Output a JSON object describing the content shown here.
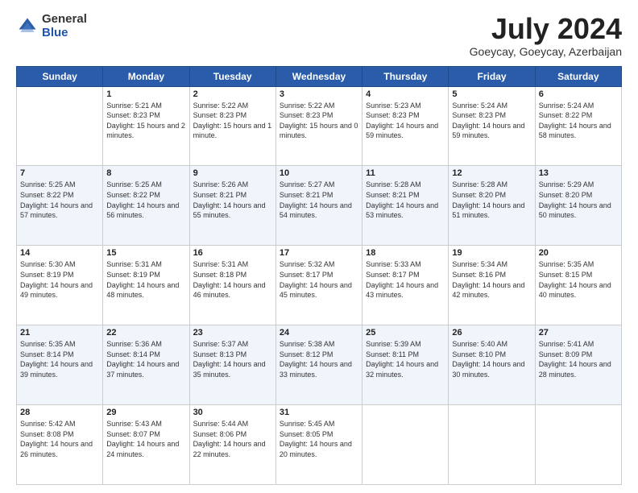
{
  "logo": {
    "general": "General",
    "blue": "Blue"
  },
  "title": "July 2024",
  "subtitle": "Goeycay, Goeycay, Azerbaijan",
  "days_header": [
    "Sunday",
    "Monday",
    "Tuesday",
    "Wednesday",
    "Thursday",
    "Friday",
    "Saturday"
  ],
  "weeks": [
    [
      {
        "day": "",
        "sunrise": "",
        "sunset": "",
        "daylight": ""
      },
      {
        "day": "1",
        "sunrise": "Sunrise: 5:21 AM",
        "sunset": "Sunset: 8:23 PM",
        "daylight": "Daylight: 15 hours and 2 minutes."
      },
      {
        "day": "2",
        "sunrise": "Sunrise: 5:22 AM",
        "sunset": "Sunset: 8:23 PM",
        "daylight": "Daylight: 15 hours and 1 minute."
      },
      {
        "day": "3",
        "sunrise": "Sunrise: 5:22 AM",
        "sunset": "Sunset: 8:23 PM",
        "daylight": "Daylight: 15 hours and 0 minutes."
      },
      {
        "day": "4",
        "sunrise": "Sunrise: 5:23 AM",
        "sunset": "Sunset: 8:23 PM",
        "daylight": "Daylight: 14 hours and 59 minutes."
      },
      {
        "day": "5",
        "sunrise": "Sunrise: 5:24 AM",
        "sunset": "Sunset: 8:23 PM",
        "daylight": "Daylight: 14 hours and 59 minutes."
      },
      {
        "day": "6",
        "sunrise": "Sunrise: 5:24 AM",
        "sunset": "Sunset: 8:22 PM",
        "daylight": "Daylight: 14 hours and 58 minutes."
      }
    ],
    [
      {
        "day": "7",
        "sunrise": "Sunrise: 5:25 AM",
        "sunset": "Sunset: 8:22 PM",
        "daylight": "Daylight: 14 hours and 57 minutes."
      },
      {
        "day": "8",
        "sunrise": "Sunrise: 5:25 AM",
        "sunset": "Sunset: 8:22 PM",
        "daylight": "Daylight: 14 hours and 56 minutes."
      },
      {
        "day": "9",
        "sunrise": "Sunrise: 5:26 AM",
        "sunset": "Sunset: 8:21 PM",
        "daylight": "Daylight: 14 hours and 55 minutes."
      },
      {
        "day": "10",
        "sunrise": "Sunrise: 5:27 AM",
        "sunset": "Sunset: 8:21 PM",
        "daylight": "Daylight: 14 hours and 54 minutes."
      },
      {
        "day": "11",
        "sunrise": "Sunrise: 5:28 AM",
        "sunset": "Sunset: 8:21 PM",
        "daylight": "Daylight: 14 hours and 53 minutes."
      },
      {
        "day": "12",
        "sunrise": "Sunrise: 5:28 AM",
        "sunset": "Sunset: 8:20 PM",
        "daylight": "Daylight: 14 hours and 51 minutes."
      },
      {
        "day": "13",
        "sunrise": "Sunrise: 5:29 AM",
        "sunset": "Sunset: 8:20 PM",
        "daylight": "Daylight: 14 hours and 50 minutes."
      }
    ],
    [
      {
        "day": "14",
        "sunrise": "Sunrise: 5:30 AM",
        "sunset": "Sunset: 8:19 PM",
        "daylight": "Daylight: 14 hours and 49 minutes."
      },
      {
        "day": "15",
        "sunrise": "Sunrise: 5:31 AM",
        "sunset": "Sunset: 8:19 PM",
        "daylight": "Daylight: 14 hours and 48 minutes."
      },
      {
        "day": "16",
        "sunrise": "Sunrise: 5:31 AM",
        "sunset": "Sunset: 8:18 PM",
        "daylight": "Daylight: 14 hours and 46 minutes."
      },
      {
        "day": "17",
        "sunrise": "Sunrise: 5:32 AM",
        "sunset": "Sunset: 8:17 PM",
        "daylight": "Daylight: 14 hours and 45 minutes."
      },
      {
        "day": "18",
        "sunrise": "Sunrise: 5:33 AM",
        "sunset": "Sunset: 8:17 PM",
        "daylight": "Daylight: 14 hours and 43 minutes."
      },
      {
        "day": "19",
        "sunrise": "Sunrise: 5:34 AM",
        "sunset": "Sunset: 8:16 PM",
        "daylight": "Daylight: 14 hours and 42 minutes."
      },
      {
        "day": "20",
        "sunrise": "Sunrise: 5:35 AM",
        "sunset": "Sunset: 8:15 PM",
        "daylight": "Daylight: 14 hours and 40 minutes."
      }
    ],
    [
      {
        "day": "21",
        "sunrise": "Sunrise: 5:35 AM",
        "sunset": "Sunset: 8:14 PM",
        "daylight": "Daylight: 14 hours and 39 minutes."
      },
      {
        "day": "22",
        "sunrise": "Sunrise: 5:36 AM",
        "sunset": "Sunset: 8:14 PM",
        "daylight": "Daylight: 14 hours and 37 minutes."
      },
      {
        "day": "23",
        "sunrise": "Sunrise: 5:37 AM",
        "sunset": "Sunset: 8:13 PM",
        "daylight": "Daylight: 14 hours and 35 minutes."
      },
      {
        "day": "24",
        "sunrise": "Sunrise: 5:38 AM",
        "sunset": "Sunset: 8:12 PM",
        "daylight": "Daylight: 14 hours and 33 minutes."
      },
      {
        "day": "25",
        "sunrise": "Sunrise: 5:39 AM",
        "sunset": "Sunset: 8:11 PM",
        "daylight": "Daylight: 14 hours and 32 minutes."
      },
      {
        "day": "26",
        "sunrise": "Sunrise: 5:40 AM",
        "sunset": "Sunset: 8:10 PM",
        "daylight": "Daylight: 14 hours and 30 minutes."
      },
      {
        "day": "27",
        "sunrise": "Sunrise: 5:41 AM",
        "sunset": "Sunset: 8:09 PM",
        "daylight": "Daylight: 14 hours and 28 minutes."
      }
    ],
    [
      {
        "day": "28",
        "sunrise": "Sunrise: 5:42 AM",
        "sunset": "Sunset: 8:08 PM",
        "daylight": "Daylight: 14 hours and 26 minutes."
      },
      {
        "day": "29",
        "sunrise": "Sunrise: 5:43 AM",
        "sunset": "Sunset: 8:07 PM",
        "daylight": "Daylight: 14 hours and 24 minutes."
      },
      {
        "day": "30",
        "sunrise": "Sunrise: 5:44 AM",
        "sunset": "Sunset: 8:06 PM",
        "daylight": "Daylight: 14 hours and 22 minutes."
      },
      {
        "day": "31",
        "sunrise": "Sunrise: 5:45 AM",
        "sunset": "Sunset: 8:05 PM",
        "daylight": "Daylight: 14 hours and 20 minutes."
      },
      {
        "day": "",
        "sunrise": "",
        "sunset": "",
        "daylight": ""
      },
      {
        "day": "",
        "sunrise": "",
        "sunset": "",
        "daylight": ""
      },
      {
        "day": "",
        "sunrise": "",
        "sunset": "",
        "daylight": ""
      }
    ]
  ]
}
